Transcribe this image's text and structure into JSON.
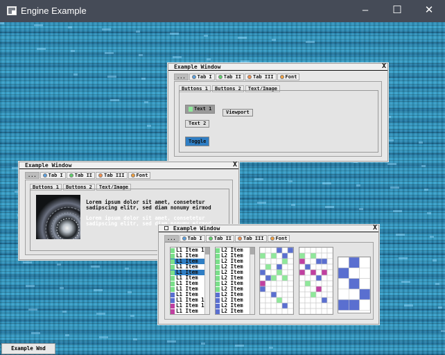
{
  "app": {
    "title": "Engine Example",
    "minimize_icon": "minimize-icon",
    "maximize_icon": "maximize-icon",
    "close_icon": "close-icon"
  },
  "window_controls": {
    "minimize": "–",
    "maximize": "☐",
    "close": "✕"
  },
  "windows": [
    {
      "title": "Example Window",
      "close_glyph": "X",
      "tabs": [
        "...",
        "Tab I",
        "Tab II",
        "Tab III",
        "Font"
      ],
      "tab_dot_colors": [
        "",
        "#5aa0e0",
        "#5fd06a",
        "#f09050",
        "#f0a040"
      ],
      "subtabs": [
        "Buttons 1",
        "Buttons 2",
        "Text/Image"
      ],
      "buttons": {
        "text1": "Text 1",
        "viewport": "Viewport",
        "text2": "Text 2",
        "toggle": "Toggle"
      }
    },
    {
      "title": "Example Window",
      "close_glyph": "X",
      "tabs": [
        "...",
        "Tab I",
        "Tab II",
        "Tab III",
        "Font"
      ],
      "subtabs": [
        "Buttons 1",
        "Buttons 2",
        "Text/Image"
      ],
      "lorem_dark": "Lorem ipsum dolor sit amet, consetetur\nsadipscing elitr, sed diam nonumy eirmod",
      "lorem_light": "Lorem ipsum dolor sit amet, consetetur\nsadipscing elitr, sed diam nonumy eirmod"
    },
    {
      "title": "Example Window",
      "close_glyph": "X",
      "tabs": [
        "...",
        "Tab I",
        "Tab II",
        "Tab III",
        "Font"
      ],
      "list1": [
        "L1 Item 1",
        "L1 Item",
        "L1 Item",
        "L1 Item",
        "L1 Item",
        "L1 Item",
        "L1 Item",
        "L1 Item",
        "L1 Item",
        "L1 Item 1",
        "L1 Item 1",
        "L1 Item"
      ],
      "list1_colors": [
        "#7adf8a",
        "#7adf8a",
        "#7adf8a",
        "#7adf8a",
        "#7adf8a",
        "#7adf8a",
        "#7adf8a",
        "#7adf8a",
        "#5a6fd0",
        "#5a6fd0",
        "#c040a0",
        "#c040a0"
      ],
      "list1_selected_rows": [
        2,
        4
      ],
      "list2": [
        "L2 Item",
        "L2 Item",
        "L2 Item",
        "L2 Item",
        "L2 Item",
        "L2 Item",
        "L2 Item",
        "L2 Item",
        "L2 Item",
        "L2 Item",
        "L2 Item",
        "L2 Item"
      ],
      "list2_colors": [
        "#7adf8a",
        "#7adf8a",
        "#7adf8a",
        "#7adf8a",
        "#7adf8a",
        "#7adf8a",
        "#7adf8a",
        "#7adf8a",
        "#5a6fd0",
        "#5a6fd0",
        "#5a6fd0",
        "#5a6fd0"
      ],
      "grid_colors": {
        "green": "#8fe89a",
        "blue": "#5a6fd0",
        "magenta": "#c040a0"
      }
    }
  ],
  "taskbar": {
    "label": "Example Wnd"
  }
}
